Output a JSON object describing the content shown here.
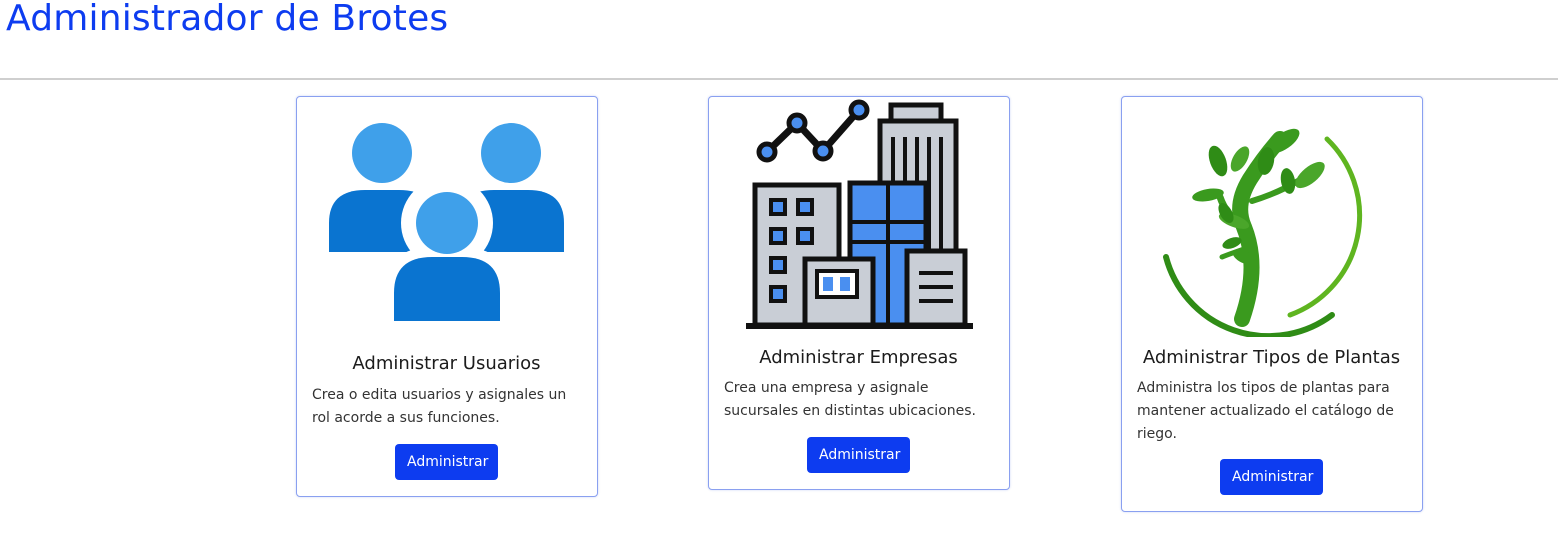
{
  "header": {
    "title": "Administrador de Brotes"
  },
  "cards": [
    {
      "title": "Administrar Usuarios",
      "text": "Crea o edita usuarios y asignales un rol acorde a sus funciones.",
      "button": "Administrar",
      "icon": "users-group-icon"
    },
    {
      "title": "Administrar Empresas",
      "text": "Crea una empresa y asignale sucursales en distintas ubicaciones.",
      "button": "Administrar",
      "icon": "company-buildings-icon"
    },
    {
      "title": "Administrar Tipos de Plantas",
      "text": "Administra los tipos de plantas para mantener actualizado el catálogo de riego.",
      "button": "Administrar",
      "icon": "plant-tree-icon"
    }
  ],
  "colors": {
    "brand": "#0d3cf0",
    "card_border": "#8aa0f0",
    "users_light": "#3fa0ea",
    "users_dark": "#0a74d0",
    "leaf_green": "#3a9a1e"
  }
}
